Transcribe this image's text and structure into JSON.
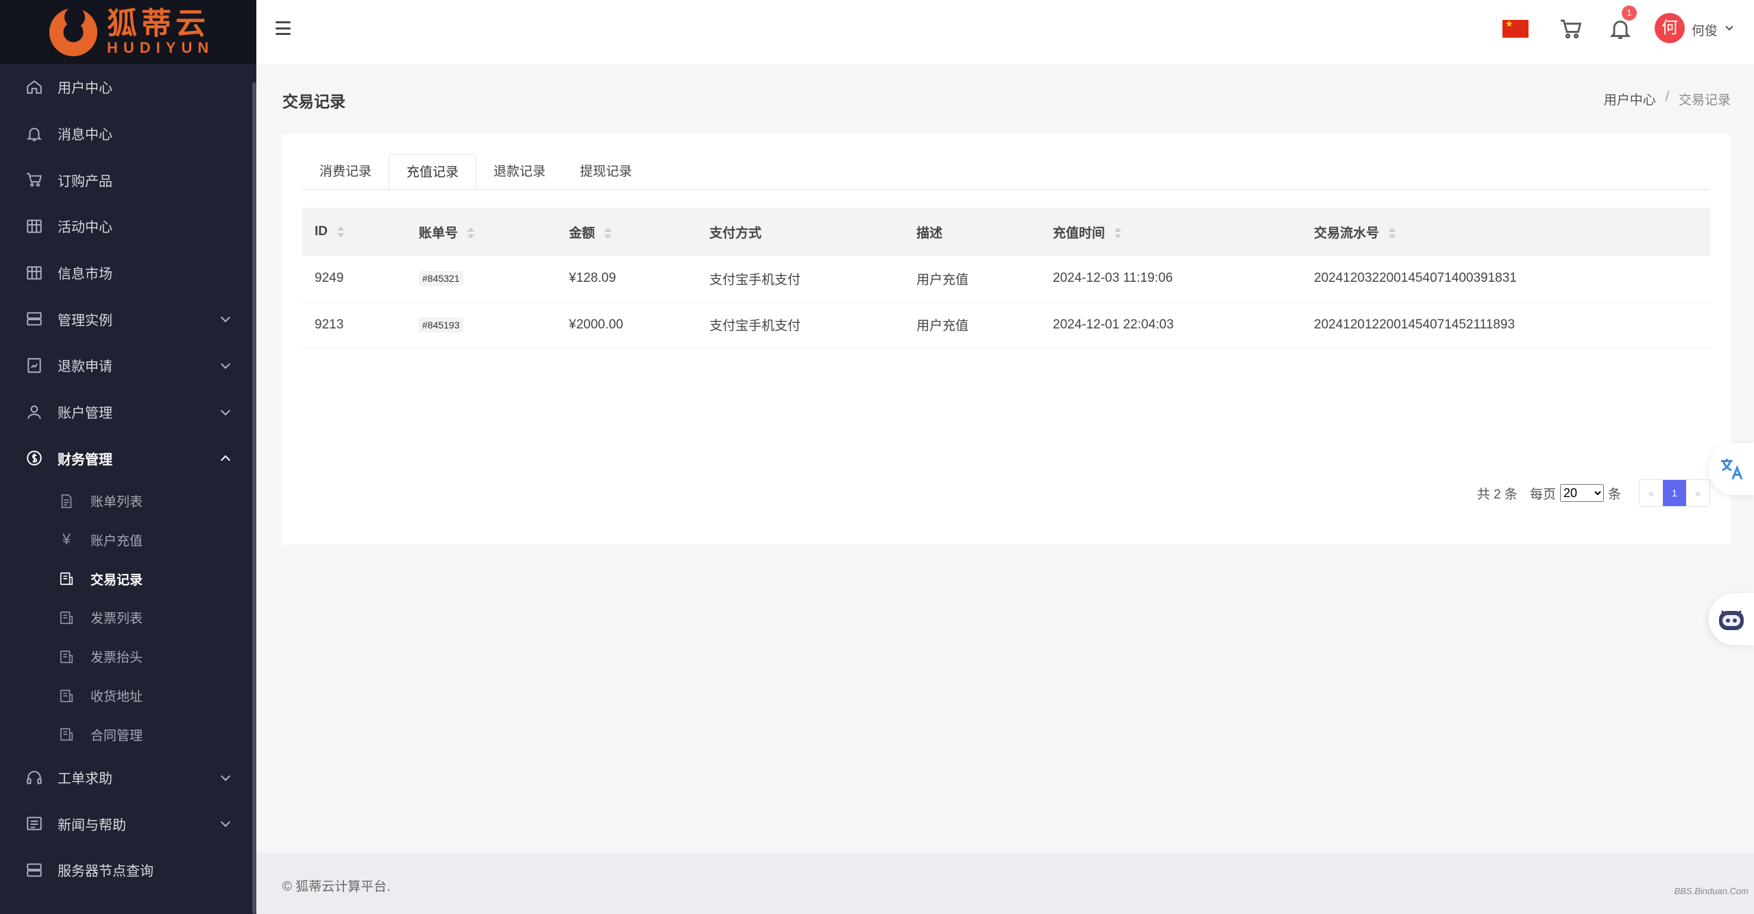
{
  "brand": {
    "name_cn": "狐蒂云",
    "name_en": "HUDIYUN"
  },
  "sidebar": {
    "items": [
      {
        "label": "用户中心",
        "icon": "home-icon"
      },
      {
        "label": "消息中心",
        "icon": "bell-icon"
      },
      {
        "label": "订购产品",
        "icon": "cart-icon"
      },
      {
        "label": "活动中心",
        "icon": "store-icon"
      },
      {
        "label": "信息市场",
        "icon": "market-icon"
      },
      {
        "label": "管理实例",
        "icon": "server-icon",
        "expandable": true
      },
      {
        "label": "退款申请",
        "icon": "refund-icon",
        "expandable": true
      },
      {
        "label": "账户管理",
        "icon": "user-icon",
        "expandable": true
      },
      {
        "label": "财务管理",
        "icon": "dollar-icon",
        "expandable": true,
        "expanded": true
      }
    ],
    "finance_sub": [
      {
        "label": "账单列表",
        "icon": "file-icon"
      },
      {
        "label": "账户充值",
        "icon": "yen-icon"
      },
      {
        "label": "交易记录",
        "icon": "ledger-icon",
        "active": true
      },
      {
        "label": "发票列表",
        "icon": "invoice-icon"
      },
      {
        "label": "发票抬头",
        "icon": "invoice-icon"
      },
      {
        "label": "收货地址",
        "icon": "address-icon"
      },
      {
        "label": "合同管理",
        "icon": "contract-icon"
      }
    ],
    "bottom_items": [
      {
        "label": "工单求助",
        "icon": "headset-icon",
        "expandable": true
      },
      {
        "label": "新闻与帮助",
        "icon": "news-icon",
        "expandable": true
      },
      {
        "label": "服务器节点查询",
        "icon": "server-icon"
      }
    ]
  },
  "header": {
    "notification_count": "1",
    "avatar_char": "何",
    "user_name": "何俊"
  },
  "page": {
    "title": "交易记录",
    "breadcrumb": [
      "用户中心",
      "交易记录"
    ]
  },
  "tabs": [
    "消费记录",
    "充值记录",
    "退款记录",
    "提现记录"
  ],
  "table": {
    "columns": [
      "ID",
      "账单号",
      "金额",
      "支付方式",
      "描述",
      "充值时间",
      "交易流水号"
    ],
    "rows": [
      {
        "id": "9249",
        "bill": "#845321",
        "amount": "¥128.09",
        "method": "支付宝手机支付",
        "desc": "用户充值",
        "time": "2024-12-03 11:19:06",
        "serial": "2024120322001454071400391831"
      },
      {
        "id": "9213",
        "bill": "#845193",
        "amount": "¥2000.00",
        "method": "支付宝手机支付",
        "desc": "用户充值",
        "time": "2024-12-01 22:04:03",
        "serial": "2024120122001454071452111893"
      }
    ]
  },
  "pager": {
    "total": "共 2 条",
    "per_page_label": "每页",
    "per_page_value": "20",
    "unit": "条",
    "prev": "«",
    "current": "1",
    "next": "»"
  },
  "footer": {
    "copyright": "© 狐蒂云计算平台."
  },
  "watermark": "BBS.Binduan.Com"
}
